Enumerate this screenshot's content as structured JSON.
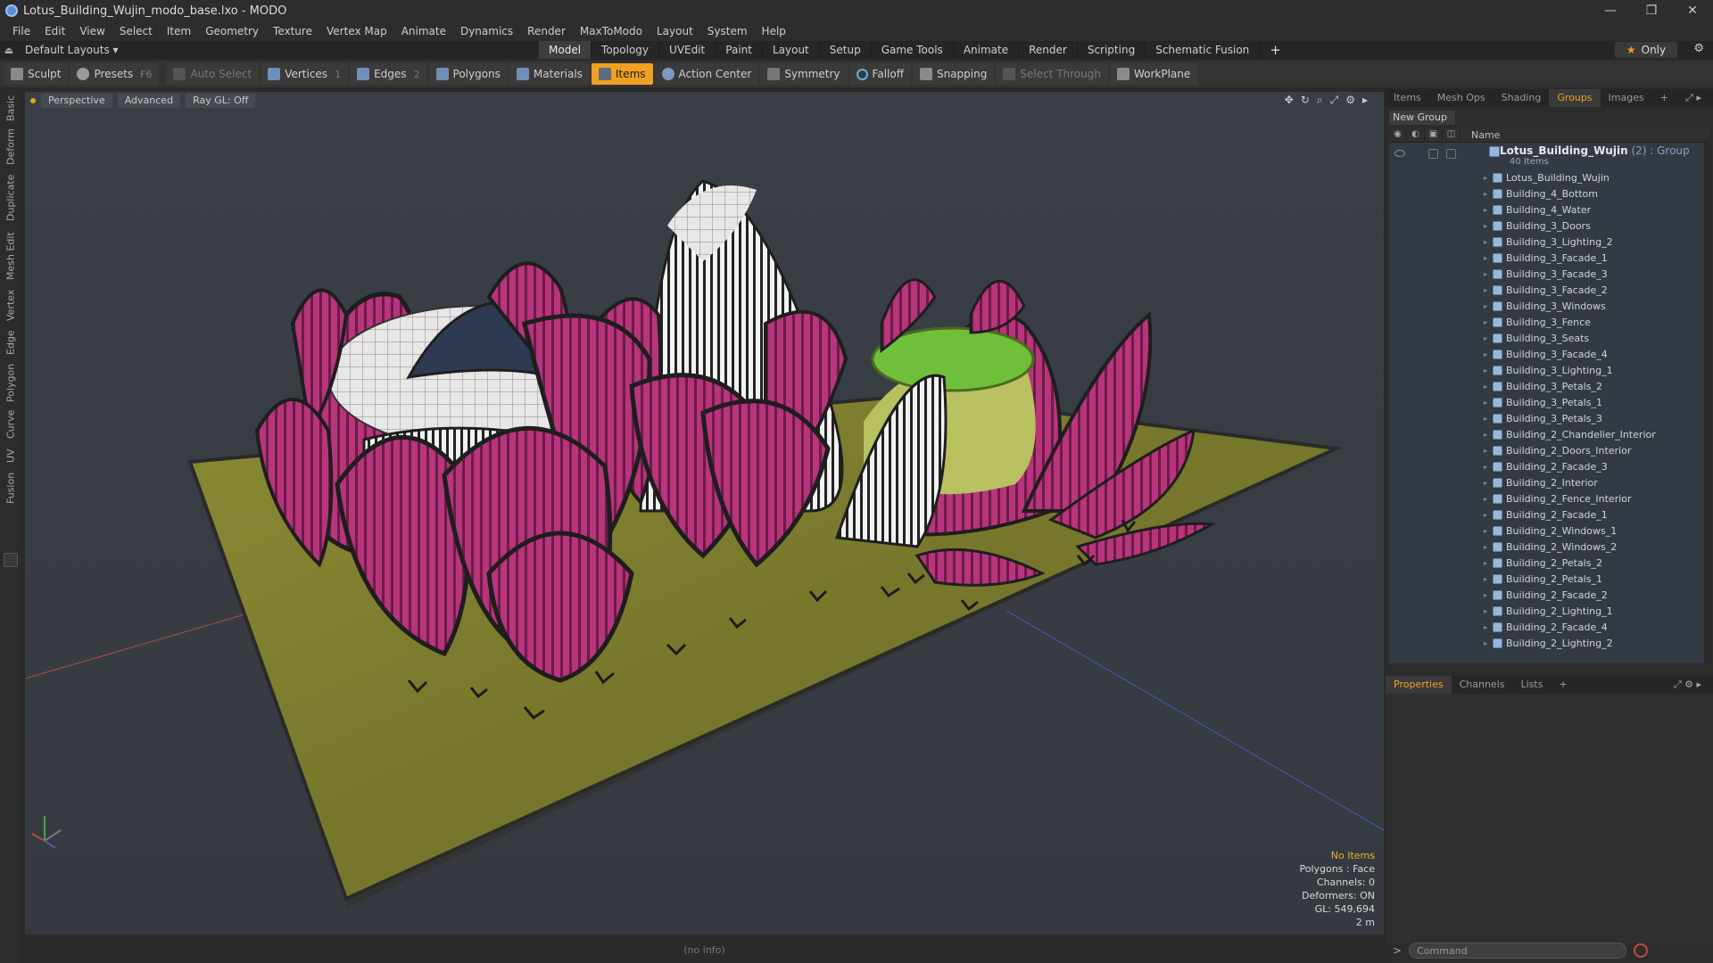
{
  "window": {
    "title": "Lotus_Building_Wujin_modo_base.lxo - MODO",
    "controls": [
      "—",
      "❐",
      "✕"
    ]
  },
  "menu": [
    "File",
    "Edit",
    "View",
    "Select",
    "Item",
    "Geometry",
    "Texture",
    "Vertex Map",
    "Animate",
    "Dynamics",
    "Render",
    "MaxToModo",
    "Layout",
    "System",
    "Help"
  ],
  "layout": {
    "selector": "Default Layouts ▾",
    "tabs": [
      "Model",
      "Topology",
      "UVEdit",
      "Paint",
      "Layout",
      "Setup",
      "Game Tools",
      "Animate",
      "Render",
      "Scripting",
      "Schematic Fusion"
    ],
    "active_tab": "Model",
    "only_label": "Only"
  },
  "toolbar": {
    "sculpt": "Sculpt",
    "presets": "Presets",
    "presets_key": "F6",
    "auto_select": "Auto Select",
    "vertices": "Vertices",
    "vertices_count": "1",
    "edges": "Edges",
    "edges_count": "2",
    "polygons": "Polygons",
    "materials": "Materials",
    "items": "Items",
    "action_center": "Action Center",
    "symmetry": "Symmetry",
    "falloff": "Falloff",
    "snapping": "Snapping",
    "select_through": "Select Through",
    "workplane": "WorkPlane"
  },
  "left_tabs": [
    "Basic",
    "Deform",
    "Duplicate",
    "Mesh Edit",
    "Vertex",
    "Edge",
    "Polygon",
    "Curve",
    "UV",
    "Fusion"
  ],
  "viewport": {
    "view": "Perspective",
    "shading": "Advanced",
    "raygl": "Ray GL: Off",
    "info": {
      "items": "No Items",
      "polygons": "Polygons : Face",
      "channels": "Channels: 0",
      "deformers": "Deformers: ON",
      "gl": "GL: 549,694",
      "scale": "2 m"
    }
  },
  "status": "(no info)",
  "panel_top": {
    "tabs": [
      "Items",
      "Mesh Ops",
      "Shading",
      "Groups",
      "Images"
    ],
    "active": "Groups",
    "new_group": "New Group",
    "column_name": "Name",
    "group": {
      "name": "Lotus_Building_Wujin",
      "count": " (2) : Group",
      "sub": "40 Items"
    },
    "items": [
      "Lotus_Building_Wujin",
      "Building_4_Bottom",
      "Building_4_Water",
      "Building_3_Doors",
      "Building_3_Lighting_2",
      "Building_3_Facade_1",
      "Building_3_Facade_3",
      "Building_3_Facade_2",
      "Building_3_Windows",
      "Building_3_Fence",
      "Building_3_Seats",
      "Building_3_Facade_4",
      "Building_3_Lighting_1",
      "Building_3_Petals_2",
      "Building_3_Petals_1",
      "Building_3_Petals_3",
      "Building_2_Chandelier_Interior",
      "Building_2_Doors_Interior",
      "Building_2_Facade_3",
      "Building_2_Interior",
      "Building_2_Fence_Interior",
      "Building_2_Facade_1",
      "Building_2_Windows_1",
      "Building_2_Windows_2",
      "Building_2_Petals_2",
      "Building_2_Petals_1",
      "Building_2_Facade_2",
      "Building_2_Lighting_1",
      "Building_2_Facade_4",
      "Building_2_Lighting_2"
    ]
  },
  "panel_bottom": {
    "tabs": [
      "Properties",
      "Channels",
      "Lists"
    ],
    "active": "Properties"
  },
  "command": {
    "placeholder": "Command"
  },
  "colors": {
    "accent": "#f0a020",
    "petal": "#b8347c",
    "ground": "#7a7a2c",
    "pool": "#6fbf3a"
  }
}
